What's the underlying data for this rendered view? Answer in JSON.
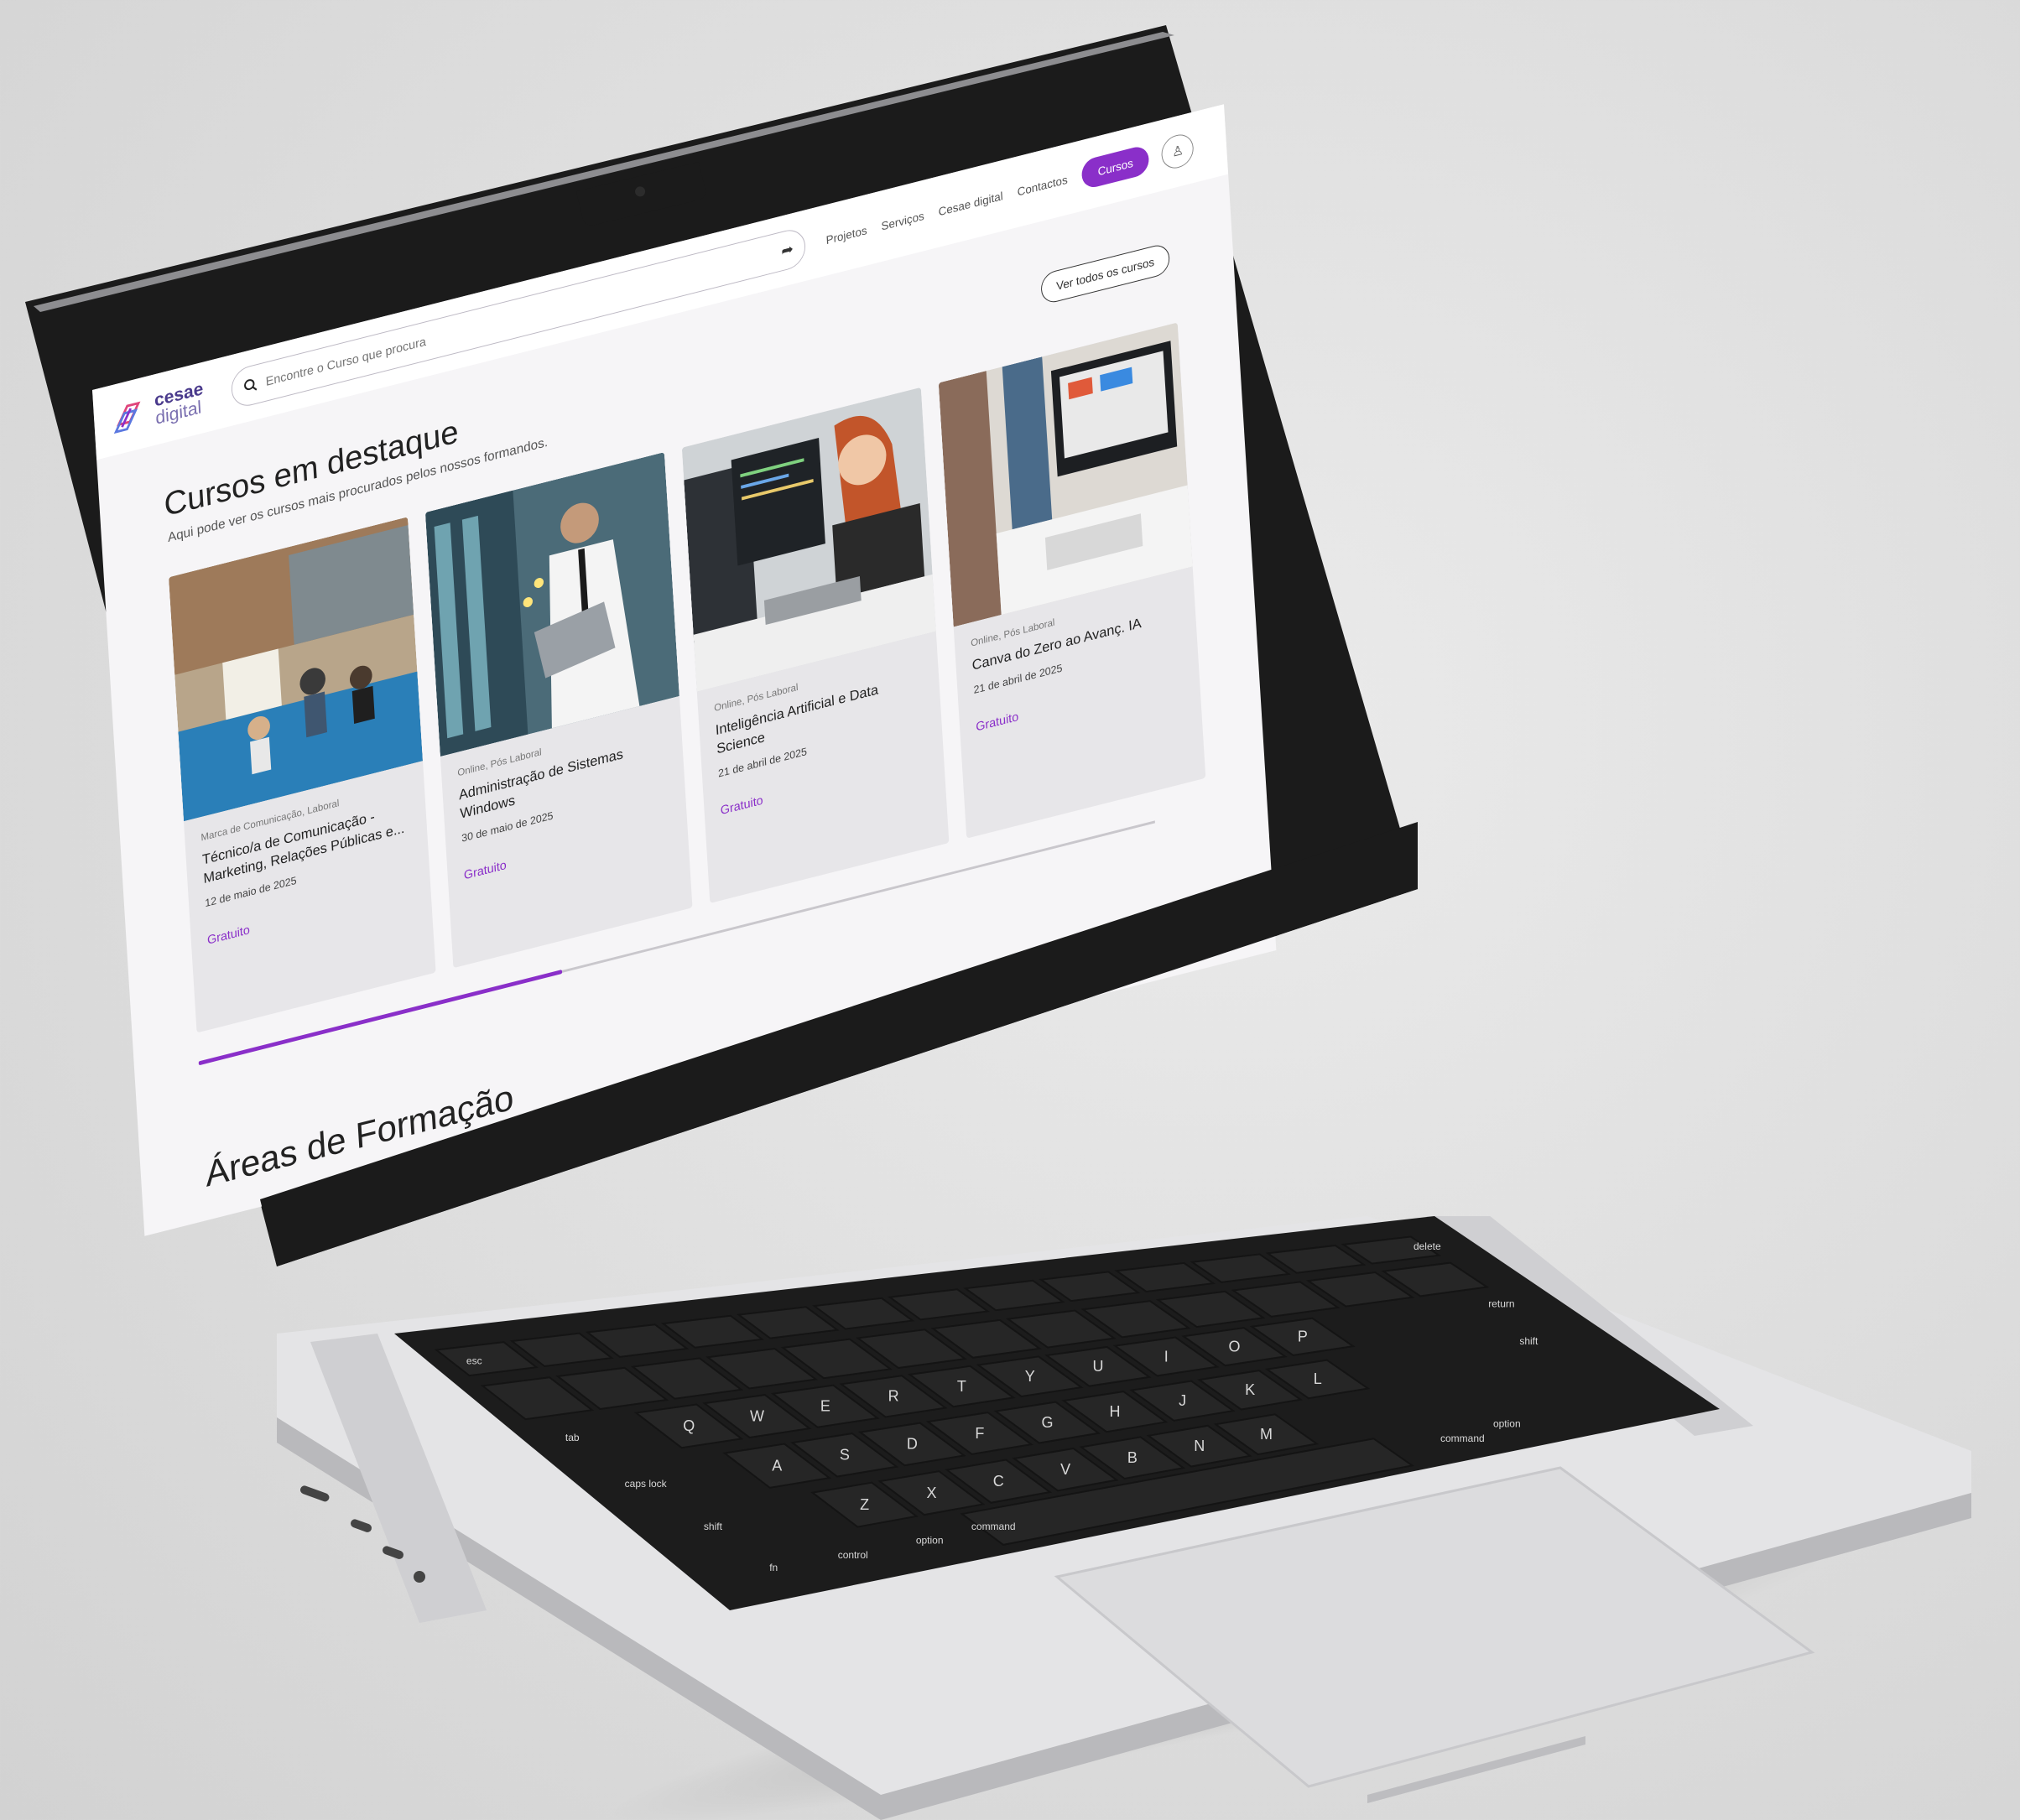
{
  "site": {
    "logo_line1": "cesae",
    "logo_line2": "digital",
    "search_placeholder": "Encontre o Curso que procura",
    "nav": [
      "Projetos",
      "Serviços",
      "Cesae digital",
      "Contactos"
    ],
    "cursos_button": "Cursos"
  },
  "featured": {
    "title": "Cursos em destaque",
    "subtitle": "Aqui pode ver os cursos mais procurados pelos nossos formandos.",
    "view_all": "Ver todos os cursos",
    "progress": 0.38,
    "cards": [
      {
        "tag": "Marca de Comunicação, Laboral",
        "title": "Técnico/a de Comunicação - Marketing, Relações Públicas e...",
        "date": "12 de maio de 2025",
        "price": "Gratuito"
      },
      {
        "tag": "Online, Pós Laboral",
        "title": "Administração de Sistemas Windows",
        "date": "30 de maio de 2025",
        "price": "Gratuito"
      },
      {
        "tag": "Online, Pós Laboral",
        "title": "Inteligência Artificial e Data Science",
        "date": "21 de abril de 2025",
        "price": "Gratuito"
      },
      {
        "tag": "Online, Pós Laboral",
        "title": "Canva do Zero ao Avanç. IA",
        "date": "21 de abril de 2025",
        "price": "Gratuito"
      }
    ]
  },
  "areas": {
    "title": "Áreas de Formação"
  },
  "keyboard": {
    "row_letters_1": [
      "Q",
      "W",
      "E",
      "R",
      "T",
      "Y",
      "U",
      "I",
      "O",
      "P"
    ],
    "row_letters_2": [
      "A",
      "S",
      "D",
      "F",
      "G",
      "H",
      "J",
      "K",
      "L"
    ],
    "row_letters_3": [
      "Z",
      "X",
      "C",
      "V",
      "B",
      "N",
      "M"
    ],
    "mods": [
      "esc",
      "tab",
      "caps lock",
      "shift",
      "fn",
      "control",
      "option",
      "command",
      "delete",
      "return",
      "shift",
      "option",
      "command"
    ]
  },
  "colors": {
    "accent": "#8a2fc9",
    "laptop_silver": "#e6e6e8",
    "keyboard_dark": "#1e1e1e",
    "bezel": "#1a1a1a"
  }
}
